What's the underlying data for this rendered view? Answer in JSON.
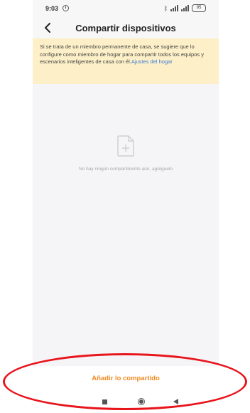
{
  "status_bar": {
    "time": "9:03",
    "battery": "95"
  },
  "header": {
    "title": "Compartir dispositivos"
  },
  "notice": {
    "text": "Si se trata de un miembro permanente de casa, se sugiere que lo configure como miembro de hogar para compartir todos los equipos y escenarios inteligentes de casa con él.",
    "link_label": "Ajustes del hogar"
  },
  "empty_state": {
    "icon": "document-plus-icon",
    "text": "No hay ningún compartimento aún, agréguelo"
  },
  "action": {
    "label": "Añadir lo compartido"
  },
  "colors": {
    "accent": "#f08a20",
    "link": "#3a7ad8",
    "notice_bg": "#fdf0c8",
    "annotation": "#e8141b"
  },
  "icons": {
    "back": "chevron-left-icon",
    "bluetooth": "bluetooth-icon",
    "signal": "signal-icon",
    "battery": "battery-icon",
    "alarm": "alarm-icon",
    "nav_recent": "square-icon",
    "nav_home": "circle-icon",
    "nav_back": "triangle-icon"
  }
}
